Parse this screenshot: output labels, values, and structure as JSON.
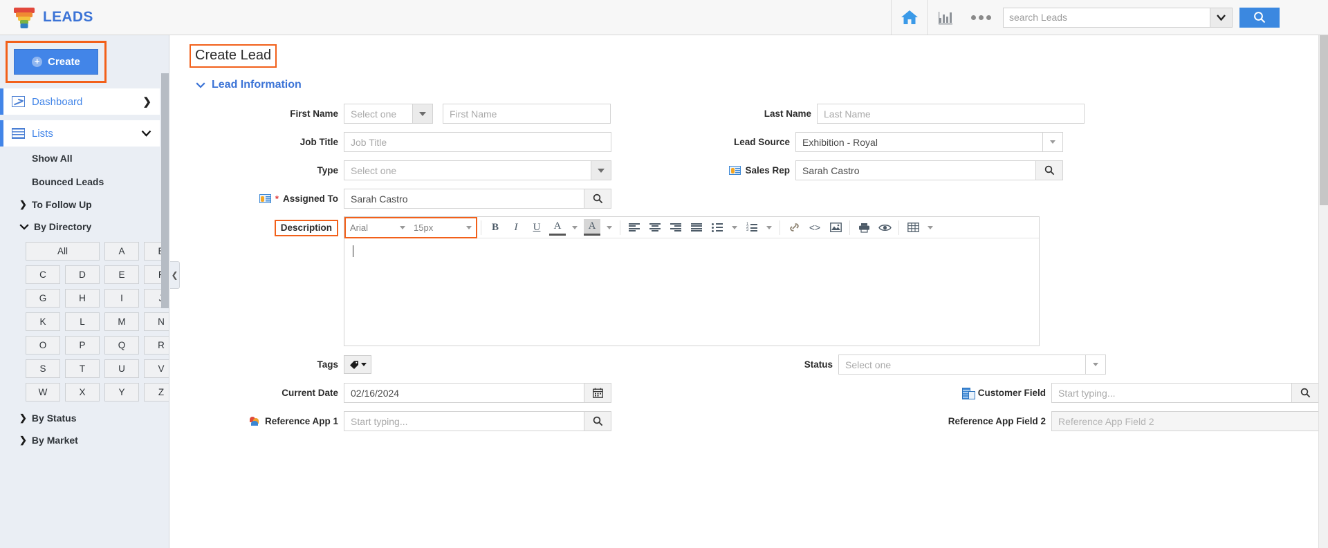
{
  "header": {
    "brand": "LEADS",
    "logo_icon": "funnel-icon",
    "home_icon": "home-icon",
    "reports_icon": "bar-chart-icon",
    "more_icon": "ellipsis-icon",
    "search_placeholder": "search Leads",
    "search_value": "",
    "search_dropdown_icon": "chevron-down-icon",
    "search_button_icon": "search-icon",
    "accent_color": "#3b88e0"
  },
  "sidebar": {
    "create_label": "Create",
    "create_icon": "plus-circle-icon",
    "highlight_color": "#f2601a",
    "nav": [
      {
        "label": "Dashboard",
        "icon": "chart-line-icon",
        "chevron": "❯"
      },
      {
        "label": "Lists",
        "icon": "grid-table-icon",
        "chevron": "⌄"
      }
    ],
    "sub_links": [
      "Show All",
      "Bounced Leads"
    ],
    "groups": [
      {
        "label": "To Follow Up",
        "caret": "❯",
        "expanded": false
      },
      {
        "label": "By Directory",
        "caret": "⌄",
        "expanded": true
      },
      {
        "label": "By Status",
        "caret": "❯",
        "expanded": false
      },
      {
        "label": "By Market",
        "caret": "❯",
        "expanded": false
      }
    ],
    "alphabet": [
      "All",
      "A",
      "B",
      "C",
      "D",
      "E",
      "F",
      "G",
      "H",
      "I",
      "J",
      "K",
      "L",
      "M",
      "N",
      "O",
      "P",
      "Q",
      "R",
      "S",
      "T",
      "U",
      "V",
      "W",
      "X",
      "Y",
      "Z"
    ],
    "collapse_icon": "chevron-left-icon"
  },
  "main": {
    "page_title": "Create Lead",
    "section": {
      "title": "Lead Information",
      "caret": "⌄"
    },
    "fields": {
      "first_name": {
        "label": "First Name",
        "salutation_placeholder": "Select one",
        "value_placeholder": "First Name",
        "value": ""
      },
      "last_name": {
        "label": "Last Name",
        "placeholder": "Last Name",
        "value": ""
      },
      "job_title": {
        "label": "Job Title",
        "placeholder": "Job Title",
        "value": ""
      },
      "lead_source": {
        "label": "Lead Source",
        "value": "Exhibition - Royal"
      },
      "type": {
        "label": "Type",
        "placeholder": "Select one",
        "value": ""
      },
      "sales_rep": {
        "label": "Sales Rep",
        "value": "Sarah Castro",
        "icon": "contact-card-icon"
      },
      "assigned_to": {
        "label": "Assigned To",
        "value": "Sarah Castro",
        "icon": "contact-card-icon",
        "required": "*"
      },
      "description": {
        "label": "Description",
        "value": ""
      },
      "tags": {
        "label": "Tags",
        "icon": "tag-icon"
      },
      "status": {
        "label": "Status",
        "placeholder": "Select one",
        "value": ""
      },
      "current_date": {
        "label": "Current Date",
        "value": "02/16/2024",
        "icon": "calendar-icon"
      },
      "customer_field": {
        "label": "Customer Field",
        "placeholder": "Start typing...",
        "value": "",
        "icon": "building-icon"
      },
      "reference_app_1": {
        "label": "Reference App 1",
        "placeholder": "Start typing...",
        "value": "",
        "icon": "reference-app-icon"
      },
      "reference_app_2": {
        "label": "Reference App Field 2",
        "placeholder": "Reference App Field 2",
        "value": ""
      }
    },
    "editor": {
      "font_family": "Arial",
      "font_size": "15px",
      "content": "",
      "tools": [
        {
          "name": "bold",
          "glyph": "B"
        },
        {
          "name": "italic",
          "glyph": "I"
        },
        {
          "name": "underline",
          "glyph": "U"
        },
        {
          "name": "font-color",
          "glyph": "A"
        },
        {
          "name": "highlight-color",
          "glyph": "A"
        },
        {
          "name": "align-left"
        },
        {
          "name": "align-center"
        },
        {
          "name": "align-right"
        },
        {
          "name": "align-justify"
        },
        {
          "name": "bullet-list"
        },
        {
          "name": "numbered-list"
        },
        {
          "name": "link",
          "glyph": "🔗"
        },
        {
          "name": "source-code",
          "glyph": "<>"
        },
        {
          "name": "image",
          "glyph": "🖼"
        },
        {
          "name": "print",
          "glyph": "🖨"
        },
        {
          "name": "preview",
          "glyph": "👁"
        },
        {
          "name": "table",
          "glyph": "▦"
        }
      ]
    }
  }
}
